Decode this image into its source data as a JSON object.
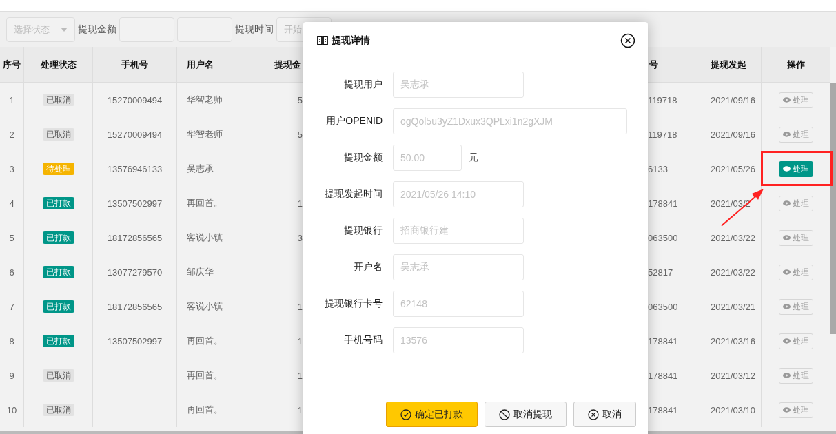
{
  "filters": {
    "status_select": {
      "placeholder": "选择状态"
    },
    "amount_label": "提现金额",
    "time_label": "提现时间",
    "start_field": {
      "placeholder": "开始"
    }
  },
  "table": {
    "columns": [
      "序号",
      "处理状态",
      "手机号",
      "用户名",
      "提现金",
      "号",
      "提现发起",
      "操作"
    ],
    "rows": [
      {
        "index": "1",
        "status": "已取消",
        "color": "#e2e2e2",
        "phone": "15270009494",
        "user": "华智老师",
        "amount": "5",
        "column_6": "119718",
        "date": "2021/09/16",
        "action": {
          "label": "处理",
          "disabled": true
        }
      },
      {
        "index": "2",
        "status": "已取消",
        "color": "#e2e2e2",
        "phone": "15270009494",
        "user": "华智老师",
        "amount": "5",
        "column_6": "119718",
        "date": "2021/09/16",
        "action": {
          "label": "处理",
          "disabled": true
        }
      },
      {
        "index": "3",
        "status": "待处理",
        "color": "#f5b400",
        "phone": "13576946133",
        "user": "吴志承",
        "amount": "",
        "column_6": "6133",
        "date": "2021/05/26",
        "action": {
          "label": "处理",
          "disabled": false
        }
      },
      {
        "index": "4",
        "status": "已打款",
        "color": "#009688",
        "phone": "13507502997",
        "user": "再回首。",
        "amount": "1",
        "column_6": "178841",
        "date": "2021/03/2",
        "action": {
          "label": "处理",
          "disabled": true
        }
      },
      {
        "index": "5",
        "status": "已打款",
        "color": "#009688",
        "phone": "18172856565",
        "user": "客说小镇",
        "amount": "3",
        "column_6": "063500",
        "date": "2021/03/22",
        "action": {
          "label": "处理",
          "disabled": true
        }
      },
      {
        "index": "6",
        "status": "已打款",
        "color": "#009688",
        "phone": "13077279570",
        "user": "邹庆华",
        "amount": "",
        "column_6": "52817",
        "date": "2021/03/22",
        "action": {
          "label": "处理",
          "disabled": true
        }
      },
      {
        "index": "7",
        "status": "已打款",
        "color": "#009688",
        "phone": "18172856565",
        "user": "客说小镇",
        "amount": "1",
        "column_6": "063500",
        "date": "2021/03/21",
        "action": {
          "label": "处理",
          "disabled": true
        }
      },
      {
        "index": "8",
        "status": "已打款",
        "color": "#009688",
        "phone": "13507502997",
        "user": "再回首。",
        "amount": "1",
        "column_6": "178841",
        "date": "2021/03/16",
        "action": {
          "label": "处理",
          "disabled": true
        }
      },
      {
        "index": "9",
        "status": "已取消",
        "color": "#e2e2e2",
        "phone": "",
        "user": "再回首。",
        "amount": "1",
        "column_6": "178841",
        "date": "2021/03/12",
        "action": {
          "label": "处理",
          "disabled": true
        }
      },
      {
        "index": "10",
        "status": "已取消",
        "color": "#e2e2e2",
        "phone": "",
        "user": "再回首。",
        "amount": "1",
        "column_6": "178841",
        "date": "2021/03/10",
        "action": {
          "label": "处理",
          "disabled": true
        }
      }
    ]
  },
  "dialog": {
    "title": "提现详情",
    "fields": [
      {
        "label": "提现用户",
        "value": "吴志承",
        "kind": "short"
      },
      {
        "label": "用户OPENID",
        "value": "ogQol5u3yZ1Dxux3QPLxi1n2gXJM",
        "kind": "long"
      },
      {
        "label": "提现金额",
        "value": "50.00",
        "kind": "amount",
        "unit": "元"
      },
      {
        "label": "提现发起时间",
        "value": "2021/05/26 14:10",
        "kind": "short"
      },
      {
        "label": "提现银行",
        "value": "招商银行建",
        "kind": "short"
      },
      {
        "label": "开户名",
        "value": "吴志承",
        "kind": "short"
      },
      {
        "label": "提现银行卡号",
        "value": "62148",
        "kind": "short"
      },
      {
        "label": "手机号码",
        "value": "13576",
        "kind": "short"
      }
    ],
    "buttons": [
      {
        "label": "确定已打款",
        "kind": "confirm"
      },
      {
        "label": "取消提现",
        "kind": "reject"
      },
      {
        "label": "取消",
        "kind": "cancel"
      }
    ]
  }
}
